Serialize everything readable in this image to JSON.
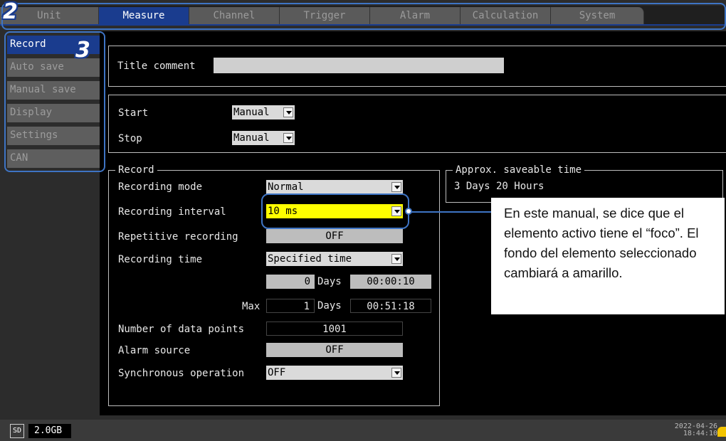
{
  "badges": {
    "tabs": "2",
    "side": "3"
  },
  "tabs": [
    {
      "label": "Unit"
    },
    {
      "label": "Measure"
    },
    {
      "label": "Channel"
    },
    {
      "label": "Trigger"
    },
    {
      "label": "Alarm"
    },
    {
      "label": "Calculation"
    },
    {
      "label": "System"
    }
  ],
  "active_tab": "Measure",
  "sidebar": {
    "items": [
      {
        "label": "Record"
      },
      {
        "label": "Auto save"
      },
      {
        "label": "Manual save"
      },
      {
        "label": "Display"
      },
      {
        "label": "Settings"
      },
      {
        "label": "CAN"
      }
    ],
    "active": "Record"
  },
  "title_comment": {
    "label": "Title comment",
    "value": ""
  },
  "start_stop": {
    "start_label": "Start",
    "start_value": "Manual",
    "stop_label": "Stop",
    "stop_value": "Manual"
  },
  "record": {
    "legend": "Record",
    "recording_mode_label": "Recording mode",
    "recording_mode_value": "Normal",
    "recording_interval_label": "Recording interval",
    "recording_interval_value": "10 ms",
    "repetitive_label": "Repetitive recording",
    "repetitive_value": "OFF",
    "recording_time_label": "Recording time",
    "recording_time_value": "Specified time",
    "time_days": "0",
    "days_label": "Days",
    "time_hms": "00:00:10",
    "max_label": "Max",
    "max_days": "1",
    "max_days_label": "Days",
    "max_hms": "00:51:18",
    "data_points_label": "Number of data points",
    "data_points_value": "1001",
    "alarm_source_label": "Alarm source",
    "alarm_source_value": "OFF",
    "sync_label": "Synchronous operation",
    "sync_value": "OFF"
  },
  "saveable": {
    "legend": "Approx. saveable time",
    "value": "3 Days 20 Hours"
  },
  "status": {
    "sd_icon_text": "SD",
    "storage": "2.0GB",
    "date": "2022-04-26",
    "time": "18:44:10"
  },
  "callout": {
    "text": "En este manual, se dice que el elemento activo tiene el “foco”. El fondo del elemento seleccionado cambiará a amarillo."
  },
  "colors": {
    "focus": "#ffff00",
    "active": "#1a3c8e",
    "annotation": "#3e74c4"
  },
  "icons": [
    "dropdown-arrow-icon",
    "sd-card-icon",
    "clock-icon"
  ]
}
